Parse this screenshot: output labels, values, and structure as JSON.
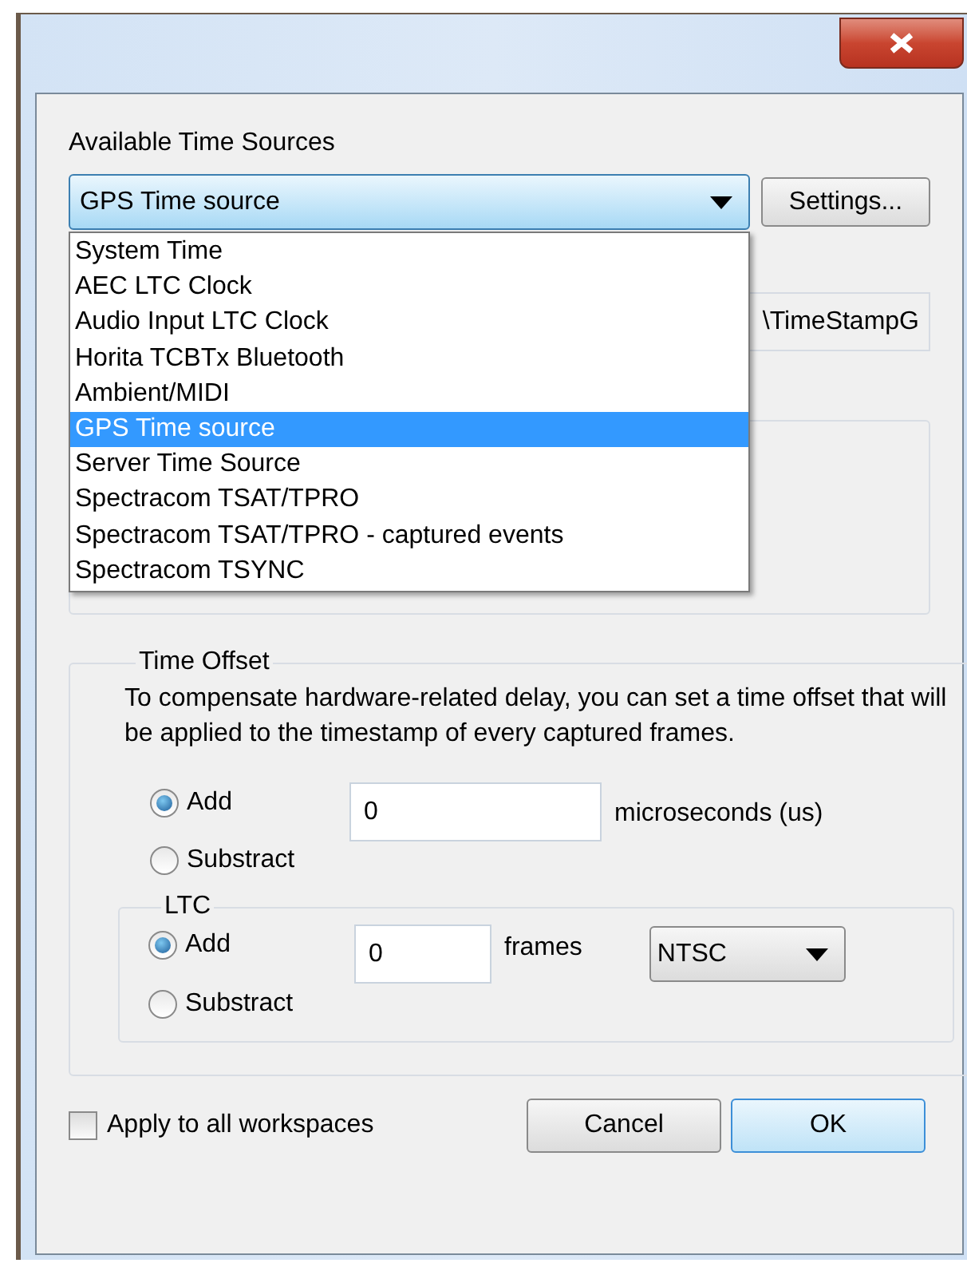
{
  "time_sources": {
    "label": "Available Time Sources",
    "value": "GPS Time source",
    "settings_button": "Settings...",
    "expanded": true,
    "options": [
      {
        "label": "System Time",
        "selected": false
      },
      {
        "label": "AEC LTC Clock",
        "selected": false
      },
      {
        "label": "Audio Input LTC Clock",
        "selected": false
      },
      {
        "label": "Horita TCBTx Bluetooth",
        "selected": false
      },
      {
        "label": "Ambient/MIDI",
        "selected": false
      },
      {
        "label": "GPS Time source",
        "selected": true
      },
      {
        "label": "Server Time Source",
        "selected": false
      },
      {
        "label": "Spectracom TSAT/TPRO",
        "selected": false
      },
      {
        "label": "Spectracom TSAT/TPRO - captured events",
        "selected": false
      },
      {
        "label": "Spectracom TSYNC",
        "selected": false
      }
    ]
  },
  "path_field": {
    "value": "\\TimeStampG"
  },
  "time_offset": {
    "title": "Time Offset",
    "description": "To compensate hardware-related delay, you can set a time offset that will be applied to the timestamp of every captured frames.",
    "radios": [
      {
        "label": "Add",
        "selected": true
      },
      {
        "label": "Substract",
        "selected": false
      }
    ],
    "value": "0",
    "unit": "microseconds (us)"
  },
  "ltc": {
    "title": "LTC",
    "radios": [
      {
        "label": "Add",
        "selected": true
      },
      {
        "label": "Substract",
        "selected": false
      }
    ],
    "value": "0",
    "unit": "frames",
    "standard": "NTSC"
  },
  "apply_all": {
    "label": "Apply to all workspaces",
    "checked": false
  },
  "buttons": [
    {
      "label": "Cancel",
      "default": false
    },
    {
      "label": "OK",
      "default": true
    }
  ]
}
